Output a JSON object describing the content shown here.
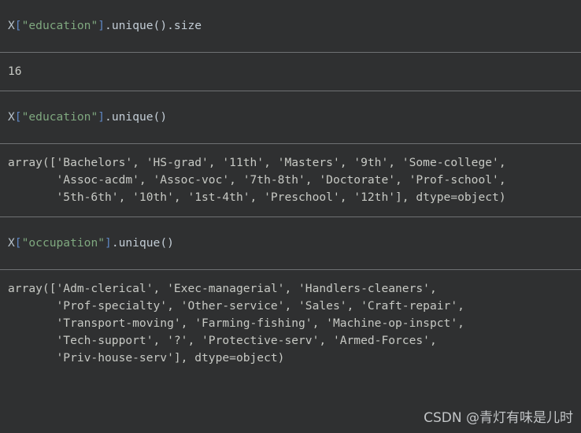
{
  "theme": {
    "background": "#2f3031",
    "divider": "#6f7173",
    "output_text": "#c7c9c4",
    "token_variable": "#b8c3cc",
    "token_punctuation": "#5f87c4",
    "token_string": "#7fa87f",
    "token_plain": "#c3cdd6",
    "watermark_color": "#cfd2d4"
  },
  "cells": [
    {
      "type": "code",
      "name": "code-cell-education-size",
      "tokens": [
        {
          "text": "X",
          "kind": "variable"
        },
        {
          "text": "[",
          "kind": "punct"
        },
        {
          "text": "\"education\"",
          "kind": "string"
        },
        {
          "text": "]",
          "kind": "punct"
        },
        {
          "text": ".unique().size",
          "kind": "plain"
        }
      ],
      "source": "X[\"education\"].unique().size"
    },
    {
      "type": "output",
      "name": "output-cell-education-size",
      "lines": [
        "16"
      ]
    },
    {
      "type": "code",
      "name": "code-cell-education-unique",
      "tokens": [
        {
          "text": "X",
          "kind": "variable"
        },
        {
          "text": "[",
          "kind": "punct"
        },
        {
          "text": "\"education\"",
          "kind": "string"
        },
        {
          "text": "]",
          "kind": "punct"
        },
        {
          "text": ".unique()",
          "kind": "plain"
        }
      ],
      "source": "X[\"education\"].unique()"
    },
    {
      "type": "output",
      "name": "output-cell-education-unique",
      "lines": [
        "array(['Bachelors', 'HS-grad', '11th', 'Masters', '9th', 'Some-college',",
        "       'Assoc-acdm', 'Assoc-voc', '7th-8th', 'Doctorate', 'Prof-school',",
        "       '5th-6th', '10th', '1st-4th', 'Preschool', '12th'], dtype=object)"
      ]
    },
    {
      "type": "code",
      "name": "code-cell-occupation-unique",
      "tokens": [
        {
          "text": "X",
          "kind": "variable"
        },
        {
          "text": "[",
          "kind": "punct"
        },
        {
          "text": "\"occupation\"",
          "kind": "string"
        },
        {
          "text": "]",
          "kind": "punct"
        },
        {
          "text": ".unique()",
          "kind": "plain"
        }
      ],
      "source": "X[\"occupation\"].unique()"
    },
    {
      "type": "output",
      "name": "output-cell-occupation-unique",
      "lines": [
        "array(['Adm-clerical', 'Exec-managerial', 'Handlers-cleaners',",
        "       'Prof-specialty', 'Other-service', 'Sales', 'Craft-repair',",
        "       'Transport-moving', 'Farming-fishing', 'Machine-op-inspct',",
        "       'Tech-support', '?', 'Protective-serv', 'Armed-Forces',",
        "       'Priv-house-serv'], dtype=object)"
      ]
    }
  ],
  "watermark": {
    "text": "CSDN @青灯有味是儿时"
  }
}
